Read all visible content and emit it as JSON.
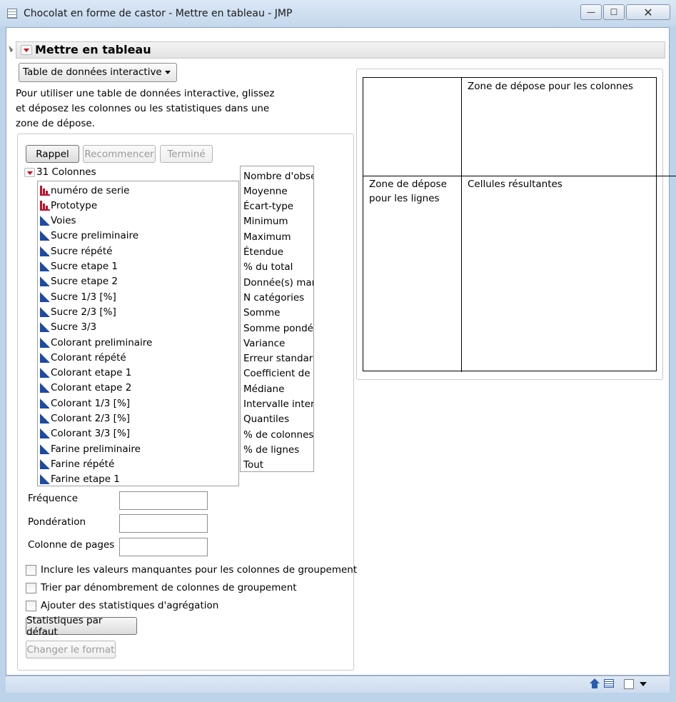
{
  "window": {
    "title": "Chocolat en forme de castor - Mettre en tableau - JMP",
    "minimize_glyph": "—",
    "maximize_glyph": "☐",
    "close_glyph": "✕"
  },
  "header": {
    "title": "Mettre en tableau"
  },
  "mode_select": {
    "value": "Table de données interactive"
  },
  "instructions": "Pour utiliser une table de données interactive, glissez et déposez les colonnes ou les statistiques dans une zone de dépose.",
  "buttons": {
    "recall": "Rappel",
    "redo": "Recommencer",
    "done": "Terminé",
    "default_stats": "Statistiques par défaut",
    "change_format": "Changer le format"
  },
  "columns": {
    "label": "31 Colonnes",
    "items": [
      {
        "name": "numéro de serie",
        "type": "nominal"
      },
      {
        "name": "Prototype",
        "type": "nominal"
      },
      {
        "name": "Voies",
        "type": "continuous"
      },
      {
        "name": "Sucre preliminaire",
        "type": "continuous"
      },
      {
        "name": "Sucre répété",
        "type": "continuous"
      },
      {
        "name": "Sucre etape 1",
        "type": "continuous"
      },
      {
        "name": "Sucre etape 2",
        "type": "continuous"
      },
      {
        "name": "Sucre 1/3 [%]",
        "type": "continuous"
      },
      {
        "name": "Sucre 2/3 [%]",
        "type": "continuous"
      },
      {
        "name": "Sucre 3/3",
        "type": "continuous"
      },
      {
        "name": "Colorant preliminaire",
        "type": "continuous"
      },
      {
        "name": "Colorant répété",
        "type": "continuous"
      },
      {
        "name": "Colorant etape 1",
        "type": "continuous"
      },
      {
        "name": "Colorant etape 2",
        "type": "continuous"
      },
      {
        "name": "Colorant 1/3 [%]",
        "type": "continuous"
      },
      {
        "name": "Colorant 2/3 [%]",
        "type": "continuous"
      },
      {
        "name": "Colorant 3/3 [%]",
        "type": "continuous"
      },
      {
        "name": "Farine preliminaire",
        "type": "continuous"
      },
      {
        "name": "Farine répété",
        "type": "continuous"
      },
      {
        "name": "Farine etape 1",
        "type": "continuous"
      }
    ]
  },
  "statistics": [
    "Nombre d'obse",
    "Moyenne",
    "Écart-type",
    "Minimum",
    "Maximum",
    "Étendue",
    "% du total",
    "Donnée(s) mar",
    "N catégories",
    "Somme",
    "Somme pondé",
    "Variance",
    "Erreur standard",
    "Coefficient de v",
    "Médiane",
    "Intervalle inter",
    "Quantiles",
    "% de colonnes",
    "% de lignes",
    "Tout"
  ],
  "roles": {
    "frequency": "Fréquence",
    "weight": "Pondération",
    "page": "Colonne de pages"
  },
  "options": {
    "include_missing": "Inclure les valeurs manquantes pour les colonnes de groupement",
    "sort_by_count": "Trier par dénombrement de colonnes de groupement",
    "add_aggregate": "Ajouter des statistiques d'agrégation"
  },
  "drop_zones": {
    "columns": "Zone de dépose pour les colonnes",
    "rows_line1": "Zone de dépose",
    "rows_line2": "pour les lignes",
    "cells": "Cellules résultantes"
  }
}
